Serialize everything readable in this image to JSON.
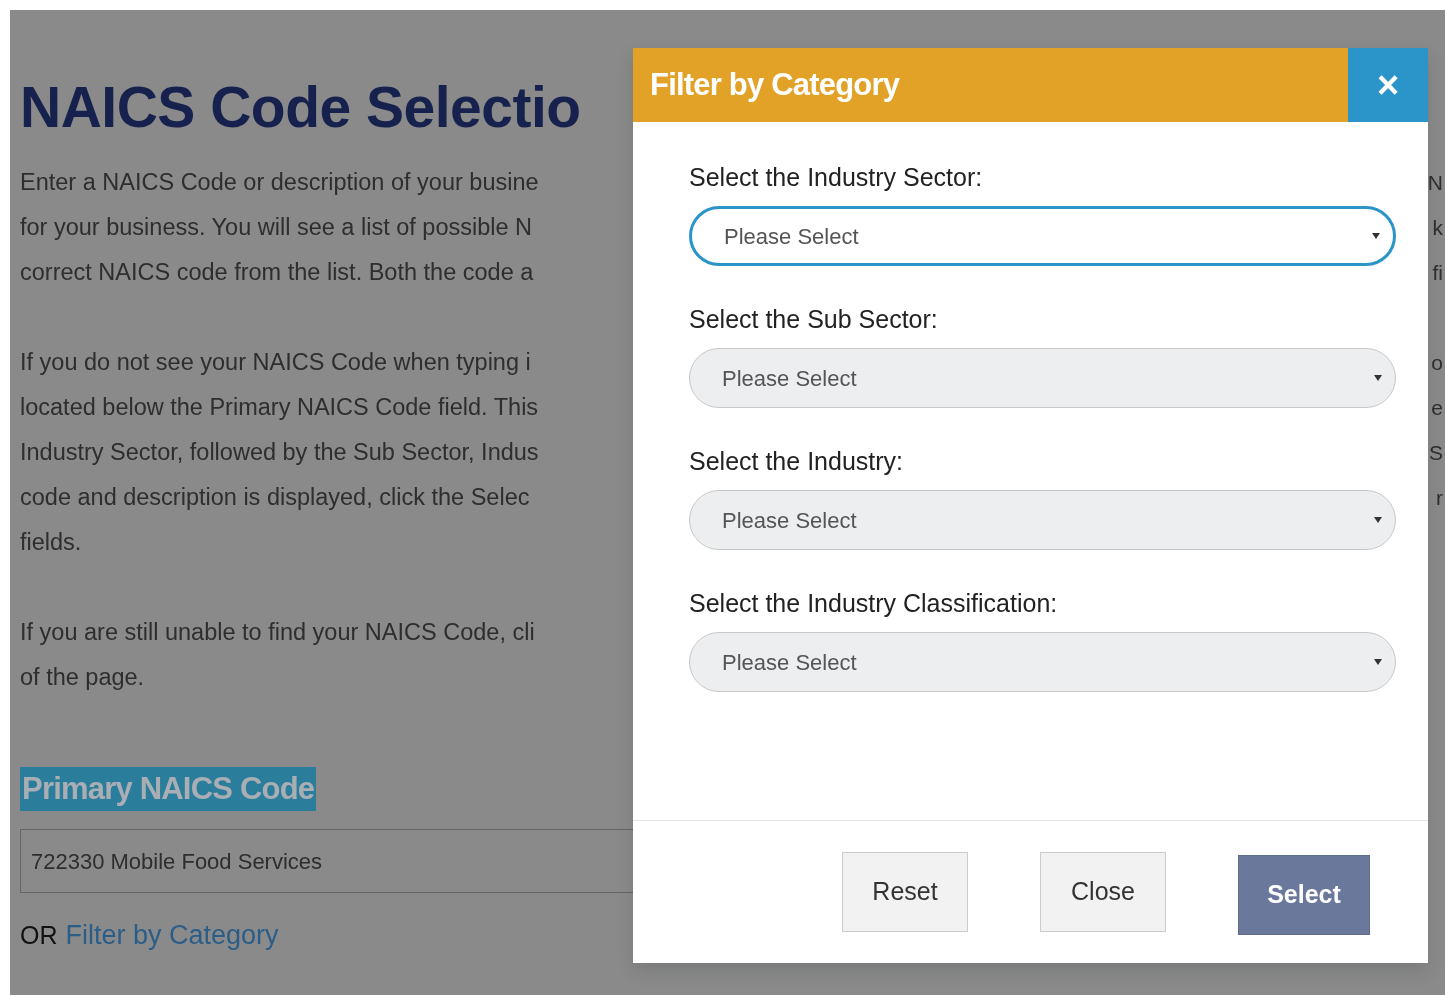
{
  "page": {
    "title": "NAICS Code Selectio",
    "paragraphs": [
      [
        {
          "left": "Enter a NAICS Code or description of your busine",
          "right": "N"
        },
        {
          "left": "for your business. You will see a list of possible N",
          "right": "k"
        },
        {
          "left": "correct NAICS code from the list. Both the code a",
          "right": "fi"
        }
      ],
      [
        {
          "left": "If you do not see your NAICS Code when typing i",
          "right": "o"
        },
        {
          "left": "located below the Primary NAICS Code field. This",
          "right": "e"
        },
        {
          "left": "Industry Sector, followed by the Sub Sector, Indus",
          "right": "S"
        },
        {
          "left": "code and description is displayed, click the Selec",
          "right": "r"
        },
        {
          "left": "fields."
        }
      ],
      [
        {
          "left": "If you are still unable to find your NAICS Code, cli"
        },
        {
          "left": "of the page."
        }
      ]
    ],
    "field_label": "Primary NAICS Code",
    "field_value": "722330 Mobile Food Services",
    "or_text": "OR",
    "link": "Filter by Category"
  },
  "modal": {
    "title": "Filter by Category",
    "close": "×",
    "fields": [
      {
        "label": "Select the Industry Sector:",
        "placeholder": "Please Select",
        "focused": true
      },
      {
        "label": "Select the Sub Sector:",
        "placeholder": "Please Select",
        "focused": false
      },
      {
        "label": "Select the Industry:",
        "placeholder": "Please Select",
        "focused": false
      },
      {
        "label": "Select the Industry Classification:",
        "placeholder": "Please Select",
        "focused": false
      }
    ],
    "buttons": [
      {
        "label": "Reset",
        "kind": "plain"
      },
      {
        "label": "Close",
        "kind": "plain"
      },
      {
        "label": "Select",
        "kind": "primary"
      }
    ]
  }
}
